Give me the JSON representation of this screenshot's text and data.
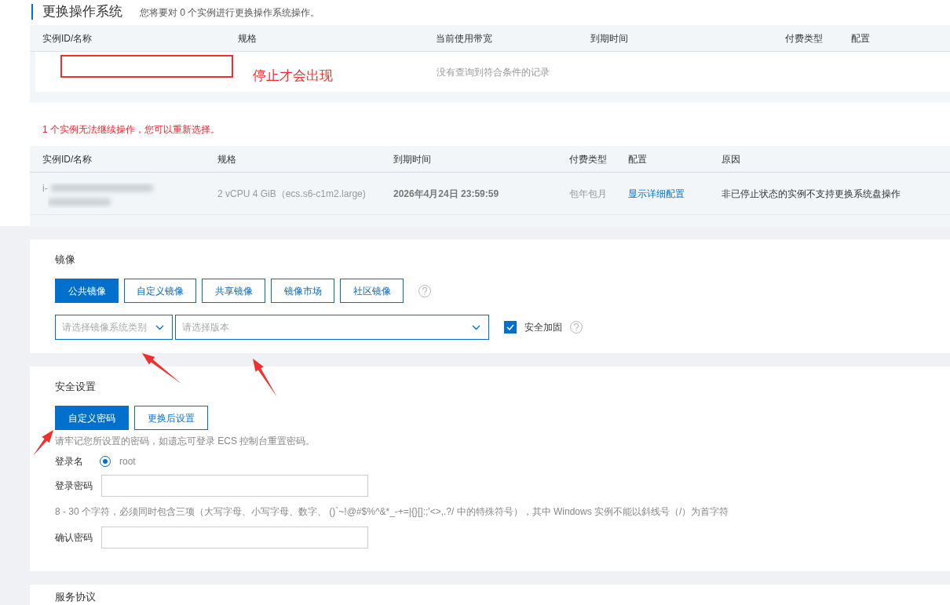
{
  "header": {
    "title": "更换操作系统",
    "subtitle": "您将要对 0 个实例进行更换操作系统操作。"
  },
  "target_table": {
    "columns": [
      "实例ID/名称",
      "规格",
      "当前使用带宽",
      "到期时间",
      "付费类型",
      "配置"
    ],
    "empty_text": "没有查询到符合条件的记录"
  },
  "annotation": {
    "note": "停止才会出现"
  },
  "warning": "1 个实例无法继续操作，您可以重新选择。",
  "blocked_table": {
    "columns": [
      "实例ID/名称",
      "规格",
      "到期时间",
      "付费类型",
      "配置",
      "原因"
    ],
    "rows": [
      {
        "instance_id": "i-",
        "spec": "2 vCPU 4 GiB（ecs.s6-c1m2.large)",
        "expires": "2026年4月24日 23:59:59",
        "billing": "包年包月",
        "config_link": "显示详细配置",
        "reason": "非已停止状态的实例不支持更换系统盘操作"
      }
    ]
  },
  "image_section": {
    "title": "镜像",
    "tabs": [
      {
        "label": "公共镜像",
        "selected": true
      },
      {
        "label": "自定义镜像",
        "selected": false
      },
      {
        "label": "共享镜像",
        "selected": false
      },
      {
        "label": "镜像市场",
        "selected": false
      },
      {
        "label": "社区镜像",
        "selected": false
      }
    ],
    "os_select": {
      "placeholder": "请选择镜像系统类别"
    },
    "version_select": {
      "placeholder": "请选择版本"
    },
    "hardening": {
      "label": "安全加固",
      "checked": true
    }
  },
  "security_section": {
    "title": "安全设置",
    "options": [
      {
        "label": "自定义密码",
        "selected": true
      },
      {
        "label": "更换后设置",
        "selected": false
      }
    ],
    "hint": "请牢记您所设置的密码，如遗忘可登录 ECS 控制台重置密码。",
    "login_name": {
      "label": "登录名",
      "value": "root",
      "selected": true
    },
    "password": {
      "label": "登录密码"
    },
    "password_rule": "8 - 30 个字符，必须同时包含三项（大写字母、小写字母、数字、 ()`~!@#$%^&*_-+=|{}[]:;'<>,.?/ 中的特殊符号），其中 Windows 实例不能以斜线号（/）为首字符",
    "confirm": {
      "label": "确认密码"
    }
  },
  "agreement_section": {
    "title": "服务协议"
  }
}
